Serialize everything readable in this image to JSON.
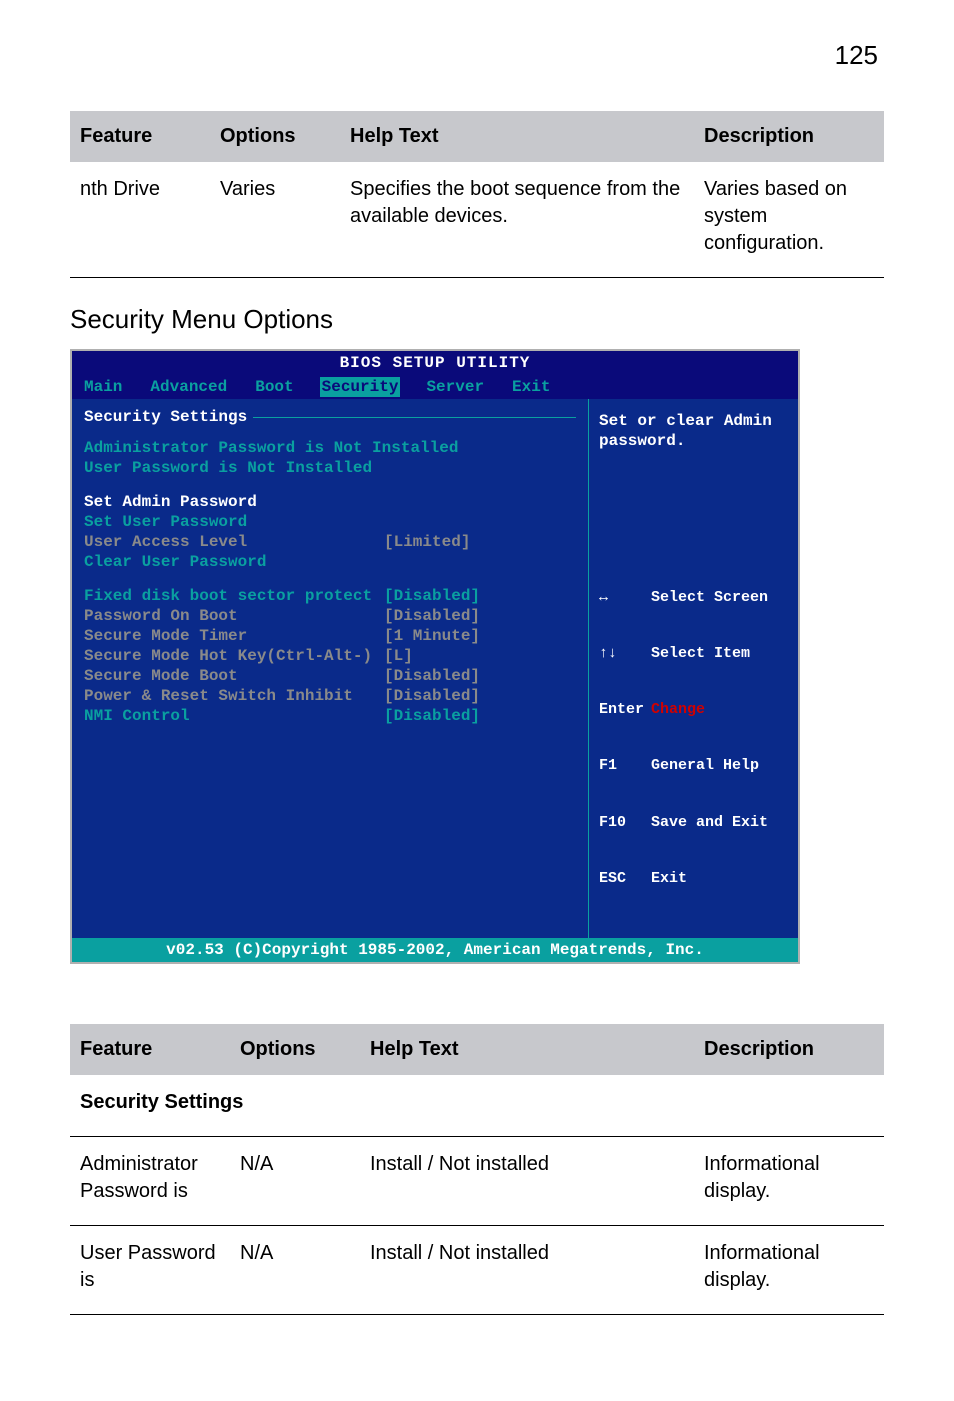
{
  "page_number": "125",
  "table1": {
    "headers": {
      "feature": "Feature",
      "options": "Options",
      "help": "Help Text",
      "desc": "Description"
    },
    "row": {
      "feature": "nth Drive",
      "options": "Varies",
      "help": "Specifies the boot sequence from the available devices.",
      "desc": "Varies based on system configuration."
    }
  },
  "section_heading": "Security Menu Options",
  "bios": {
    "title": "BIOS SETUP UTILITY",
    "tabs": [
      "Main",
      "Advanced",
      "Boot",
      "Security",
      "Server",
      "Exit"
    ],
    "active_tab": "Security",
    "panel_title": "Security Settings",
    "status1": "Administrator Password is  Not Installed",
    "status2": "User Password is Not Installed",
    "items": {
      "set_admin": "Set Admin Password",
      "set_user": "Set User Password",
      "user_access": {
        "label": "User Access Level",
        "value": "[Limited]"
      },
      "clear_user": "Clear User Password",
      "fixed_disk": {
        "label": "Fixed disk boot sector protect",
        "value": "[Disabled]"
      },
      "pwd_on_boot": {
        "label": "Password On Boot",
        "value": "[Disabled]"
      },
      "secure_timer": {
        "label": "Secure Mode Timer",
        "value": "[1 Minute]"
      },
      "secure_hotkey": {
        "label": "Secure Mode Hot Key(Ctrl-Alt-)",
        "value": "[L]"
      },
      "secure_boot": {
        "label": "Secure Mode Boot",
        "value": "[Disabled]"
      },
      "power_reset": {
        "label": "Power & Reset Switch Inhibit",
        "value": "[Disabled]"
      },
      "nmi": {
        "label": "NMI Control",
        "value": "[Disabled]"
      }
    },
    "help_hint": "Set or clear Admin\npassword.",
    "nav": [
      {
        "key": "↔",
        "action": "Select Screen"
      },
      {
        "key": "↑↓",
        "action": "Select Item"
      },
      {
        "key": "Enter",
        "action": "Change",
        "enter": true
      },
      {
        "key": "F1",
        "action": "General Help"
      },
      {
        "key": "F10",
        "action": "Save and Exit"
      },
      {
        "key": "ESC",
        "action": "Exit"
      }
    ],
    "footer": "v02.53 (C)Copyright 1985-2002, American Megatrends, Inc."
  },
  "table2": {
    "headers": {
      "feature": "Feature",
      "options": "Options",
      "help": "Help Text",
      "desc": "Description"
    },
    "section": "Security Settings",
    "rows": [
      {
        "feature": "Administrator Password is",
        "options": "N/A",
        "help": "Install / Not installed",
        "desc": "Informational display."
      },
      {
        "feature": "User Password is",
        "options": "N/A",
        "help": "Install / Not installed",
        "desc": "Informational display."
      }
    ]
  }
}
